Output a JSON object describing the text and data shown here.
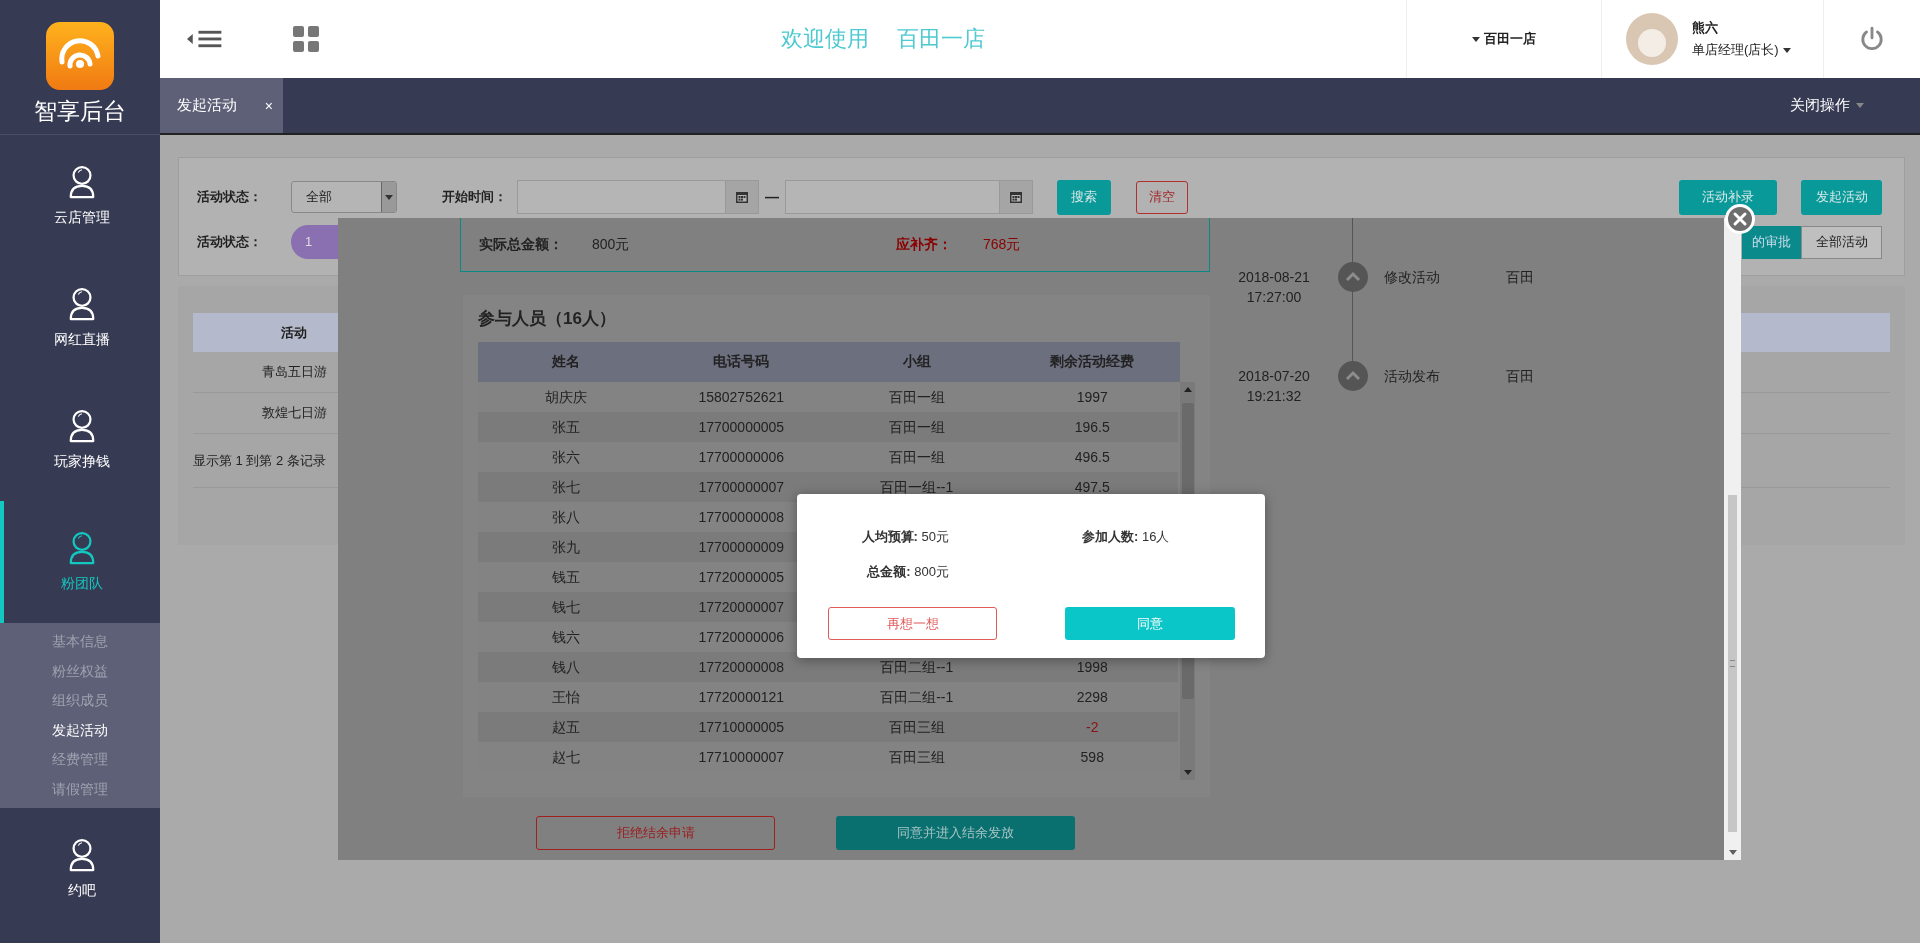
{
  "sidebar": {
    "logo_text": "智享后台",
    "items": [
      {
        "label": "云店管理",
        "selected": false
      },
      {
        "label": "网红直播",
        "selected": false
      },
      {
        "label": "玩家挣钱",
        "selected": false
      },
      {
        "label": "粉团队",
        "selected": true,
        "children": [
          {
            "label": "基本信息",
            "selected": false
          },
          {
            "label": "粉丝权益",
            "selected": false
          },
          {
            "label": "组织成员",
            "selected": false
          },
          {
            "label": "发起活动",
            "selected": true
          },
          {
            "label": "经费管理",
            "selected": false
          },
          {
            "label": "请假管理",
            "selected": false
          }
        ]
      },
      {
        "label": "约吧",
        "selected": false
      }
    ]
  },
  "header": {
    "welcome": "欢迎使用",
    "store_title": "百田一店",
    "store_switch": "百田一店",
    "user_name": "熊六",
    "user_role": "单店经理(店长)"
  },
  "tabs": [
    {
      "label": "发起活动",
      "selected": true,
      "close": "×"
    }
  ],
  "close_ops": "关闭操作",
  "filter": {
    "status_label": "活动状态：",
    "status_value": "全部",
    "time_label": "开始时间：",
    "dash": "—",
    "search": "搜索",
    "clear": "清空",
    "supplement": "活动补录",
    "launch": "发起活动",
    "status_label_2": "活动状态：",
    "status_pill": "1",
    "view_tabs": [
      {
        "label": "的审批",
        "selected": true
      },
      {
        "label": "全部活动",
        "selected": false
      }
    ]
  },
  "activity_table": {
    "columns": [
      "活动"
    ],
    "rows": [
      [
        "青岛五日游"
      ],
      [
        "敦煌七日游"
      ]
    ],
    "footer": "显示第 1 到第 2 条记录"
  },
  "modal": {
    "summary": {
      "actual_label": "实际总金额：",
      "actual_value": "800元",
      "due_label": "应补齐：",
      "due_value": "768元"
    },
    "timeline": [
      {
        "date": "2018-08-21",
        "time": "17:27:00",
        "action": "修改活动",
        "operator": "百田"
      },
      {
        "date": "2018-07-20",
        "time": "19:21:32",
        "action": "活动发布",
        "operator": "百田"
      }
    ],
    "participants": {
      "title": "参与人员（16人）",
      "columns": [
        "姓名",
        "电话号码",
        "小组",
        "剩余活动经费"
      ],
      "rows": [
        {
          "name": "胡庆庆",
          "phone": "15802752621",
          "group": "百田一组",
          "fund": "1997",
          "negative": false
        },
        {
          "name": "张五",
          "phone": "17700000005",
          "group": "百田一组",
          "fund": "196.5",
          "negative": false
        },
        {
          "name": "张六",
          "phone": "17700000006",
          "group": "百田一组",
          "fund": "496.5",
          "negative": false
        },
        {
          "name": "张七",
          "phone": "17700000007",
          "group": "百田一组--1",
          "fund": "497.5",
          "negative": false
        },
        {
          "name": "张八",
          "phone": "17700000008"
        },
        {
          "name": "张九",
          "phone": "17700000009"
        },
        {
          "name": "钱五",
          "phone": "17720000005"
        },
        {
          "name": "钱七",
          "phone": "17720000007"
        },
        {
          "name": "钱六",
          "phone": "17720000006"
        },
        {
          "name": "钱八",
          "phone": "17720000008",
          "group": "百田二组--1",
          "fund": "1998",
          "negative": false
        },
        {
          "name": "王怡",
          "phone": "17720000121",
          "group": "百田二组--1",
          "fund": "2298",
          "negative": false
        },
        {
          "name": "赵五",
          "phone": "17710000005",
          "group": "百田三组",
          "fund": "-2",
          "negative": true
        },
        {
          "name": "赵七",
          "phone": "17710000007",
          "group": "百田三组",
          "fund": "598",
          "negative": false
        }
      ]
    },
    "reject": "拒绝结余申请",
    "approve": "同意并进入结余发放"
  },
  "confirm": {
    "fields": [
      {
        "label": "人均预算:",
        "value": "50元"
      },
      {
        "label": "参加人数:",
        "value": "16人"
      },
      {
        "label": "总金额:",
        "value": "800元"
      }
    ],
    "cancel": "再想一想",
    "ok": "同意"
  }
}
